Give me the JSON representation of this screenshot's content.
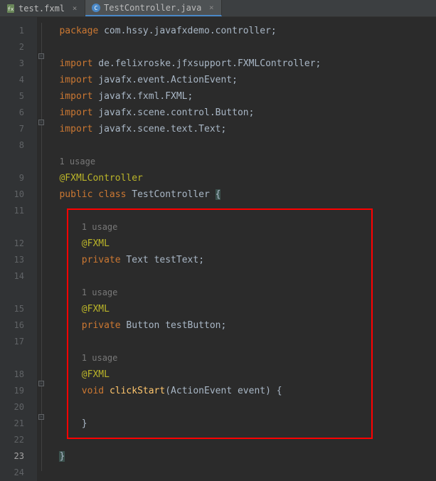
{
  "tabs": [
    {
      "label": "test.fxml",
      "icon": "fxml"
    },
    {
      "label": "TestController.java",
      "icon": "java"
    }
  ],
  "code": {
    "line1_kw": "package",
    "line1_rest": " com.hssy.javafxdemo.controller;",
    "line3_kw": "import",
    "line3_rest": " de.felixroske.jfxsupport.FXMLController;",
    "line4_kw": "import",
    "line4_rest": " javafx.event.ActionEvent;",
    "line5_kw": "import",
    "line5_rest": " javafx.fxml.FXML;",
    "line6_kw": "import",
    "line6_rest": " javafx.scene.control.Button;",
    "line7_kw": "import",
    "line7_rest": " javafx.scene.text.Text;",
    "usage1": "1 usage",
    "line9_ann": "@FXMLController",
    "line10_kw1": "public",
    "line10_kw2": "class",
    "line10_name": "TestController",
    "line10_brace": "{",
    "usage2": "1 usage",
    "line12_ann": "@FXML",
    "line13_kw": "private",
    "line13_type": "Text",
    "line13_name": "testText",
    "line13_semi": ";",
    "usage3": "1 usage",
    "line15_ann": "@FXML",
    "line16_kw": "private",
    "line16_type": "Button",
    "line16_name": "testButton",
    "line16_semi": ";",
    "usage4": "1 usage",
    "line18_ann": "@FXML",
    "line19_kw": "void",
    "line19_name": "clickStart",
    "line19_p1": "(",
    "line19_ptype": "ActionEvent",
    "line19_pname": "event",
    "line19_p2": ")",
    "line19_brace": "{",
    "line21_brace": "}",
    "line23_brace": "}"
  },
  "lineNumbers": [
    "1",
    "2",
    "3",
    "4",
    "5",
    "6",
    "7",
    "8",
    "",
    "9",
    "10",
    "11",
    "",
    "12",
    "13",
    "14",
    "",
    "15",
    "16",
    "17",
    "",
    "18",
    "19",
    "20",
    "21",
    "22",
    "23",
    "24"
  ]
}
